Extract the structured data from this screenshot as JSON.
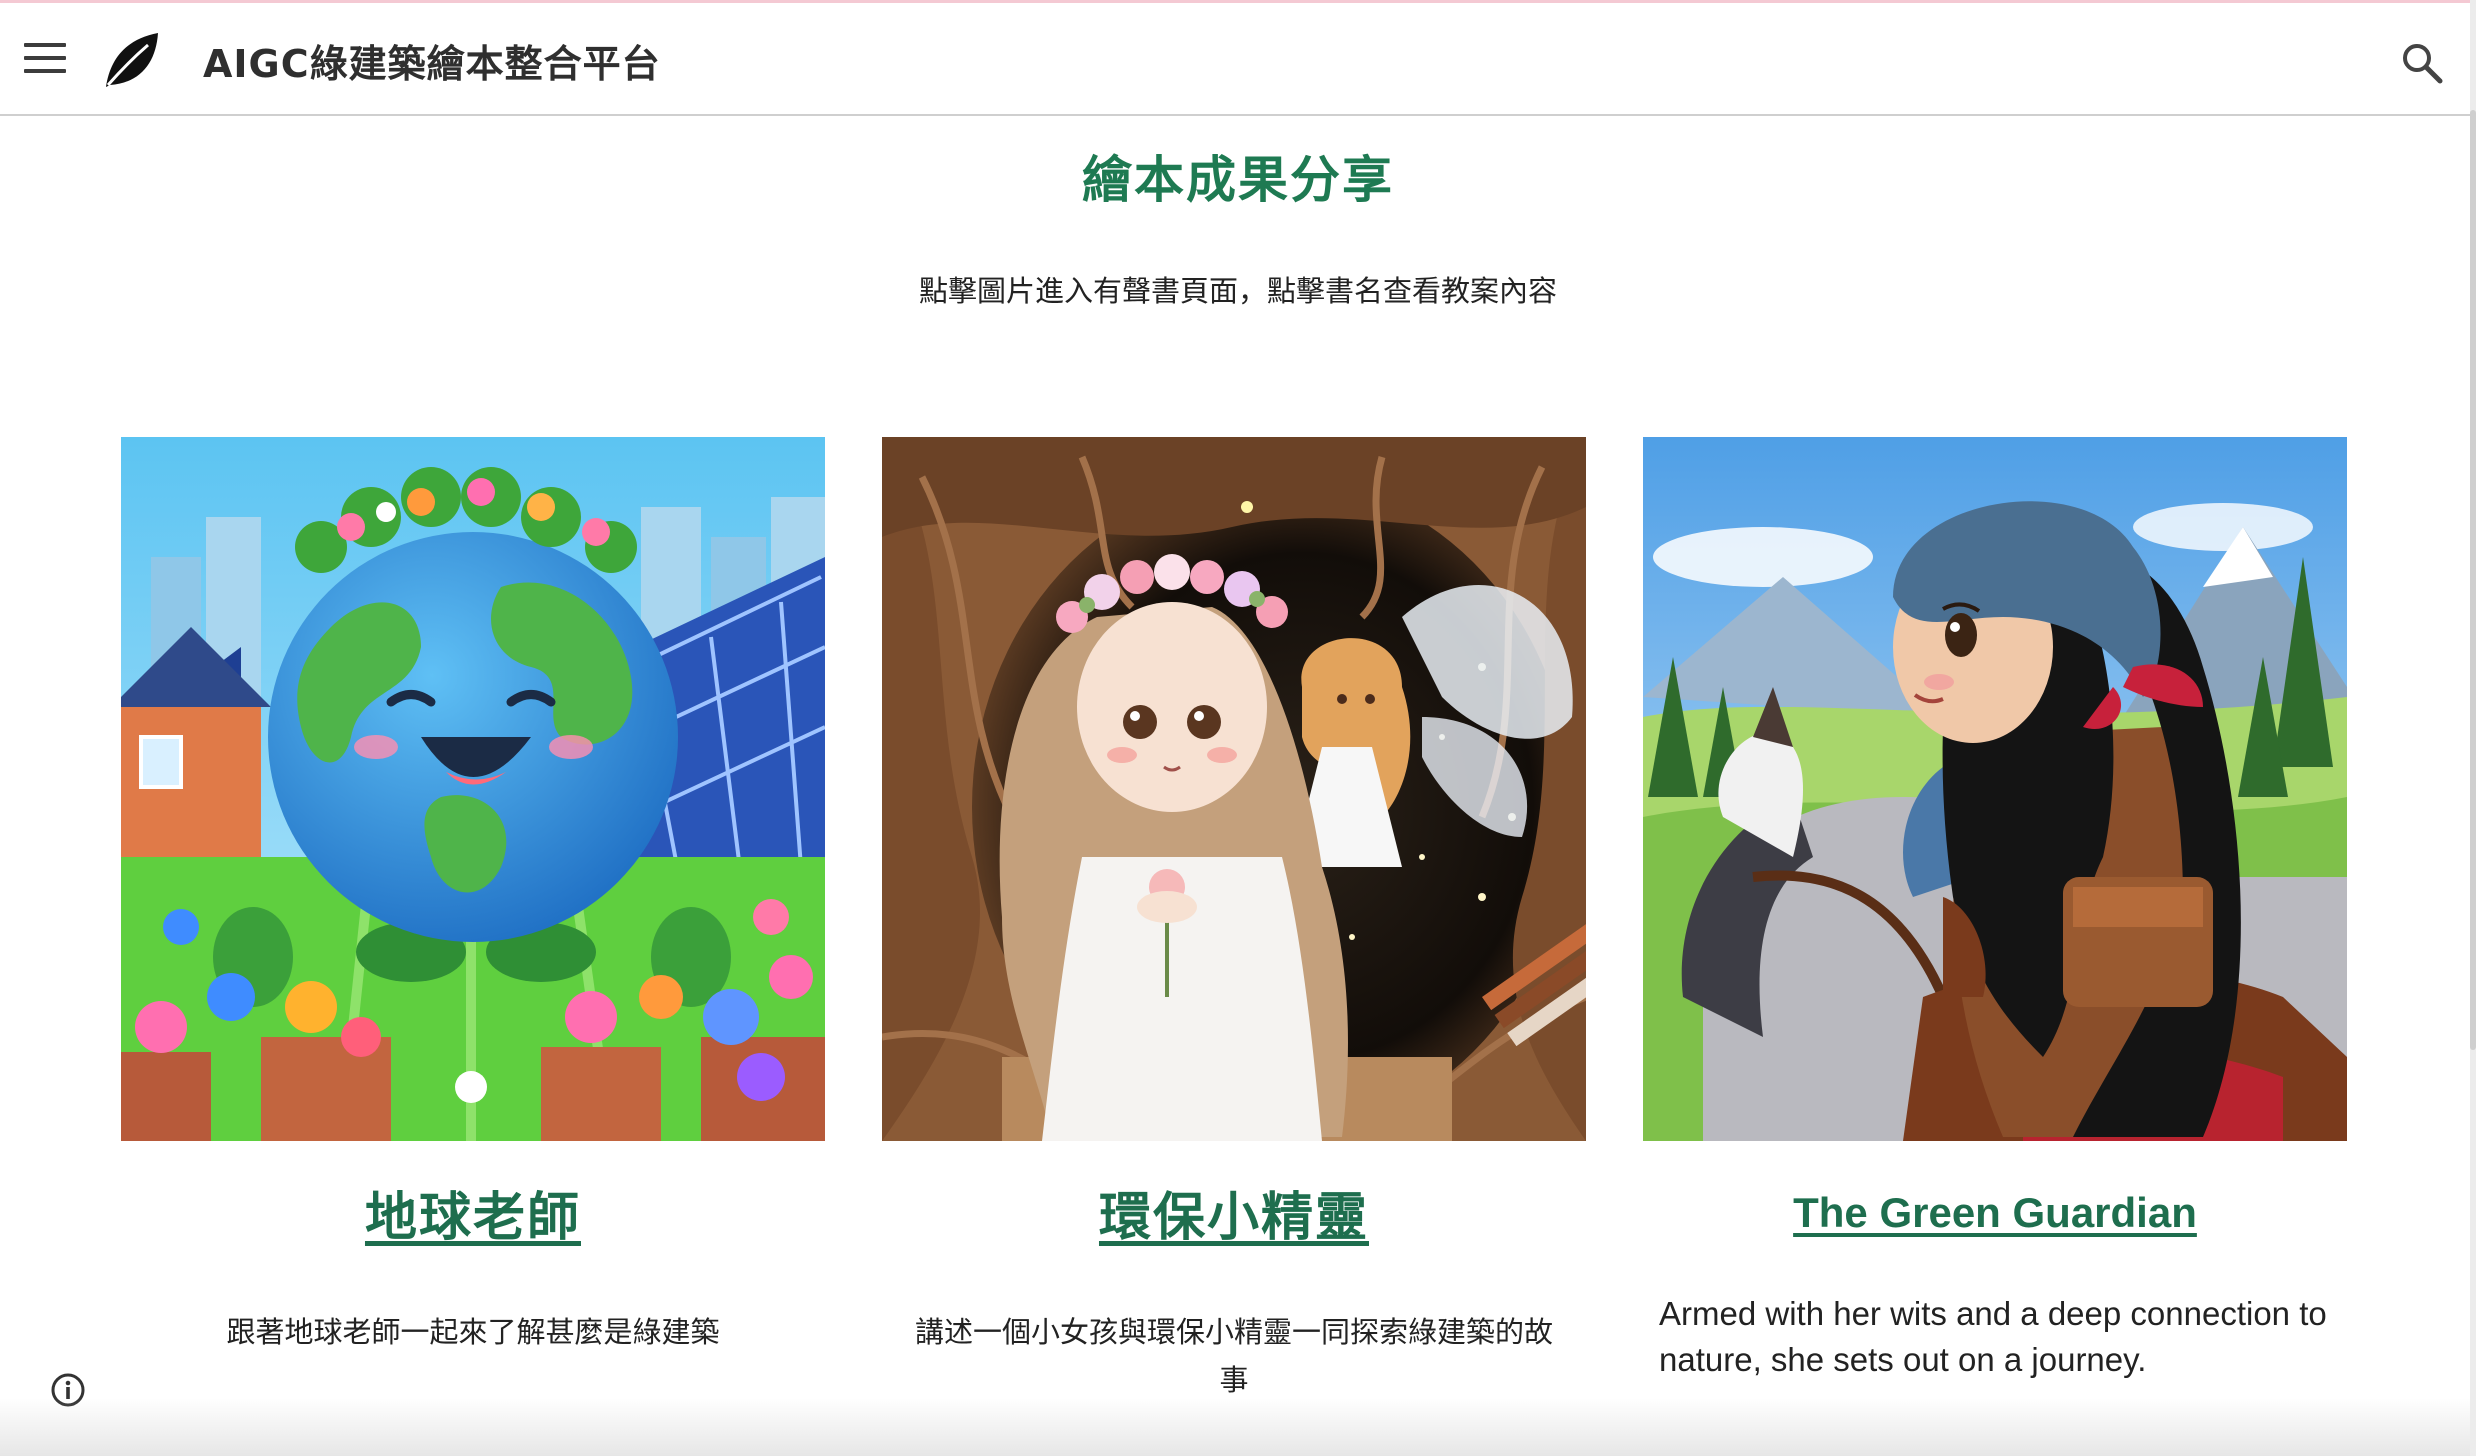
{
  "header": {
    "site_title": "AIGC綠建築繪本整合平台",
    "menu_icon": "hamburger-menu-icon",
    "logo_icon": "leaf-icon",
    "search_icon": "search-icon"
  },
  "main": {
    "section_title": "繪本成果分享",
    "section_subtitle": "點擊圖片進入有聲書頁面，點擊書名查看教案內容",
    "cards": [
      {
        "title": "地球老師",
        "description": "跟著地球老師一起來了解甚麼是綠建築",
        "image": "smiling-earth-character-with-solar-panels-and-flowers"
      },
      {
        "title": "環保小精靈",
        "description_line1": "講述一個小女孩與環保小精靈一同探索綠建築的故",
        "description_line2": "事",
        "image": "girl-with-flower-crown-and-fairy-in-tree-cave"
      },
      {
        "title": "The Green Guardian",
        "description_line1": "Armed with her wits and a deep connection to",
        "description_line2": "nature, she sets out on a journey.",
        "image": "girl-with-headscarf-riding-horse-in-meadow"
      }
    ]
  },
  "footer": {
    "info_icon": "info-icon"
  },
  "colors": {
    "accent_green": "#1e7a52",
    "title_link": "#1e6e4e"
  }
}
